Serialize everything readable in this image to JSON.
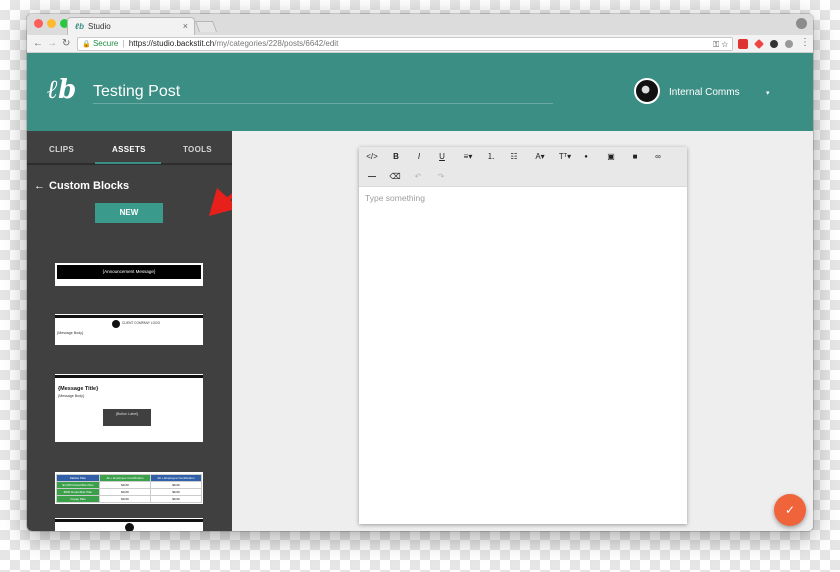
{
  "browser": {
    "tab_title": "Studio",
    "tab_close": "×",
    "secure_label": "Secure",
    "url_host": "https://studio.backstit.ch",
    "url_path": "/my/categories/228/posts/6642/edit"
  },
  "header": {
    "logo_text": "ℓb",
    "post_title": "Testing Post",
    "org_name": "Internal Comms",
    "org_caret": "▾"
  },
  "sidebar": {
    "tabs": [
      {
        "label": "CLIPS"
      },
      {
        "label": "ASSETS"
      },
      {
        "label": "TOOLS"
      }
    ],
    "back_arrow": "←",
    "section_title": "Custom Blocks",
    "new_button": "NEW",
    "blocks": [
      {
        "label": "{Announcement Message}"
      },
      {
        "logo_text": "CLIENT COMPANY LOGO",
        "body": "{Message Body}"
      },
      {
        "title": "{Message Title}",
        "body": "{Message Body}",
        "button": "{Button Label}"
      },
      {
        "header": [
          "Market Plan",
          "All + Employee Contribution",
          "All + Employee Contribution"
        ],
        "rows": [
          [
            "$1,000 Deductible Plan",
            "$0.00",
            "$0.00"
          ],
          [
            "$500 Deductible Plan",
            "$0.00",
            "$0.00"
          ],
          [
            "Copay Plan",
            "$0.00",
            "$0.00"
          ]
        ]
      }
    ]
  },
  "editor": {
    "toolbar_row1": [
      "</>",
      "B",
      "I",
      "U",
      "≡▾",
      "⒈",
      "☷",
      "A▾",
      "Tᵀ▾",
      "●",
      "▣",
      "■",
      "∞"
    ],
    "toolbar_row2": [
      "—",
      "⌫",
      "↶",
      "↷"
    ],
    "placeholder": "Type something"
  },
  "fab": {
    "icon": "✓"
  },
  "colors": {
    "brand_teal": "#3a8e84",
    "sidebar_bg": "#404040",
    "fab_orange": "#f0643b",
    "annotation_arrow": "#e8201c"
  }
}
